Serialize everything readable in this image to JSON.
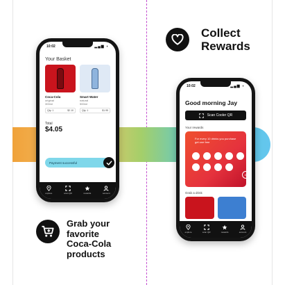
{
  "headings": {
    "collect_rewards_line1": "Collect",
    "collect_rewards_line2": "Rewards",
    "grab_line1": "Grab your",
    "grab_line2": "favorite",
    "grab_line3": "Coca-Cola",
    "grab_line4": "products"
  },
  "phone_left": {
    "time": "10:02",
    "basket_title": "Your Basket",
    "products": [
      {
        "name": "Coca-Cola",
        "variant": "original",
        "size": "300ml",
        "qty_label": "Qty: 1",
        "price": "$2.10"
      },
      {
        "name": "Smart Water",
        "variant": "natural",
        "size": "500ml",
        "qty_label": "Qty: 1",
        "price": "$1.95"
      }
    ],
    "total_label": "Total",
    "total_value": "$4.05",
    "payment_status": "Payment successful",
    "tabs": [
      "explore",
      "scan QR",
      "rewards",
      "account"
    ]
  },
  "phone_right": {
    "time": "10:02",
    "greeting": "Good morning Jay",
    "scan_button": "Scan Cooler QR",
    "rewards_label": "Your rewards",
    "rewards_text": "For every 10 drinks you purchase get one free",
    "reward_target": "10",
    "grab_label": "Grab a drink",
    "tabs": [
      "explore",
      "scan QR",
      "rewards",
      "account"
    ]
  },
  "colors": {
    "band_start": "#f0a23a",
    "band_end": "#64c6ee",
    "coke_red": "#c9141d",
    "payment_pill": "#7fd7ea",
    "guide_line": "#c44fcf"
  },
  "icons": [
    "heart-icon",
    "cart-icon",
    "check-icon",
    "scan-icon",
    "location-pin-icon",
    "star-icon",
    "user-icon"
  ]
}
